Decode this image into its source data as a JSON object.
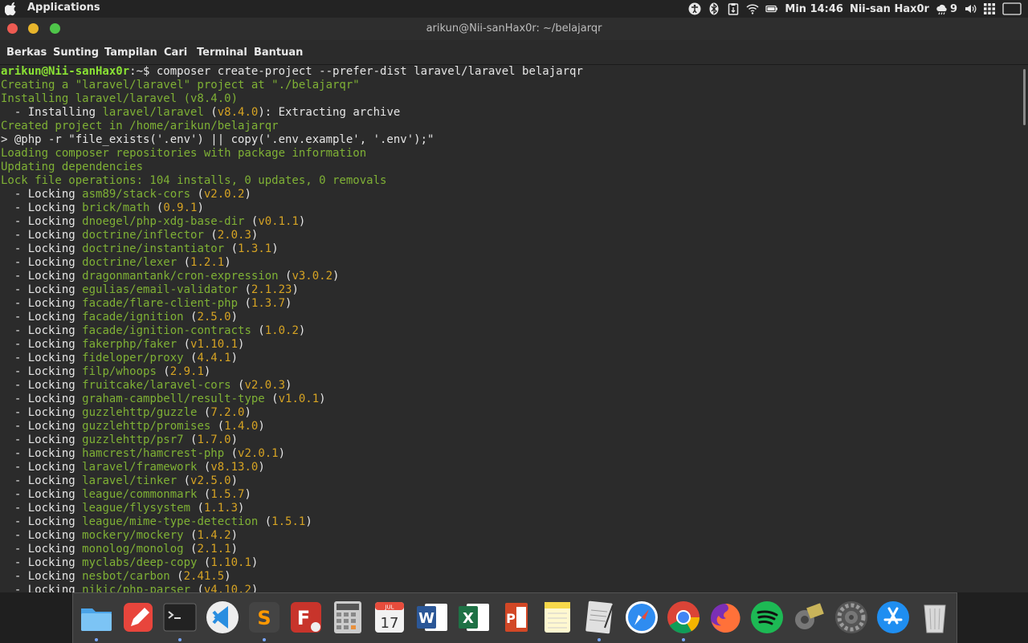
{
  "topbar": {
    "apps_label": "Applications",
    "clock": "Min 14:46",
    "user": "Nii-san Hax0r",
    "notif_count": "9",
    "icons": [
      "apple-icon",
      "accessibility-icon",
      "bluetooth-icon",
      "clipboard-icon",
      "wifi-icon",
      "battery-icon",
      "weather-icon",
      "volume-icon",
      "grid-icon",
      "window-icon"
    ]
  },
  "window": {
    "title": "arikun@Nii-sanHax0r: ~/belajarqr"
  },
  "menu": [
    "Berkas",
    "Sunting",
    "Tampilan",
    "Cari",
    "Terminal",
    "Bantuan"
  ],
  "terminal": {
    "prompt_user": "arikun@Nii-sanHax0r",
    "prompt_path": ":~$ ",
    "command": "composer create-project --prefer-dist laravel/laravel belajarqr",
    "lines": [
      {
        "t": "Creating a \"laravel/laravel\" project at \"./belajarqr\"",
        "c": "green"
      },
      {
        "t": "Installing laravel/laravel (v8.4.0)",
        "c": "green"
      },
      {
        "t": "  - Installing ",
        "c": "white",
        "pkg": "laravel/laravel",
        "ver": "v8.4.0",
        "tail": ": Extracting archive"
      },
      {
        "t": "Created project in /home/arikun/belajarqr",
        "c": "green"
      },
      {
        "t": "> @php -r \"file_exists('.env') || copy('.env.example', '.env');\"",
        "c": "white"
      },
      {
        "t": "Loading composer repositories with package information",
        "c": "green"
      },
      {
        "t": "Updating dependencies",
        "c": "green"
      },
      {
        "t": "Lock file operations: 104 installs, 0 updates, 0 removals",
        "c": "green"
      }
    ],
    "locks": [
      [
        "asm89/stack-cors",
        "v2.0.2"
      ],
      [
        "brick/math",
        "0.9.1"
      ],
      [
        "dnoegel/php-xdg-base-dir",
        "v0.1.1"
      ],
      [
        "doctrine/inflector",
        "2.0.3"
      ],
      [
        "doctrine/instantiator",
        "1.3.1"
      ],
      [
        "doctrine/lexer",
        "1.2.1"
      ],
      [
        "dragonmantank/cron-expression",
        "v3.0.2"
      ],
      [
        "egulias/email-validator",
        "2.1.23"
      ],
      [
        "facade/flare-client-php",
        "1.3.7"
      ],
      [
        "facade/ignition",
        "2.5.0"
      ],
      [
        "facade/ignition-contracts",
        "1.0.2"
      ],
      [
        "fakerphp/faker",
        "v1.10.1"
      ],
      [
        "fideloper/proxy",
        "4.4.1"
      ],
      [
        "filp/whoops",
        "2.9.1"
      ],
      [
        "fruitcake/laravel-cors",
        "v2.0.3"
      ],
      [
        "graham-campbell/result-type",
        "v1.0.1"
      ],
      [
        "guzzlehttp/guzzle",
        "7.2.0"
      ],
      [
        "guzzlehttp/promises",
        "1.4.0"
      ],
      [
        "guzzlehttp/psr7",
        "1.7.0"
      ],
      [
        "hamcrest/hamcrest-php",
        "v2.0.1"
      ],
      [
        "laravel/framework",
        "v8.13.0"
      ],
      [
        "laravel/tinker",
        "v2.5.0"
      ],
      [
        "league/commonmark",
        "1.5.7"
      ],
      [
        "league/flysystem",
        "1.1.3"
      ],
      [
        "league/mime-type-detection",
        "1.5.1"
      ],
      [
        "mockery/mockery",
        "1.4.2"
      ],
      [
        "monolog/monolog",
        "2.1.1"
      ],
      [
        "myclabs/deep-copy",
        "1.10.1"
      ],
      [
        "nesbot/carbon",
        "2.41.5"
      ],
      [
        "nikic/php-parser",
        "v4.10.2"
      ]
    ],
    "lock_prefix": "  - Locking "
  },
  "dock": {
    "items": [
      {
        "name": "files-icon",
        "color": "#4aa3e8",
        "running": true
      },
      {
        "name": "pencil-app-icon",
        "color": "#e8453c",
        "running": false
      },
      {
        "name": "terminal-icon",
        "color": "#222222",
        "running": true
      },
      {
        "name": "vscode-icon",
        "color": "#2a8ee0",
        "running": false
      },
      {
        "name": "sublime-text-icon",
        "color": "#444444",
        "running": true
      },
      {
        "name": "filezilla-icon",
        "color": "#c8342b",
        "running": false
      },
      {
        "name": "calculator-icon",
        "color": "#b0b0b0",
        "running": false
      },
      {
        "name": "calendar-icon",
        "color": "#f2f2f2",
        "running": false
      },
      {
        "name": "word-icon",
        "color": "#2b5797",
        "running": false
      },
      {
        "name": "excel-icon",
        "color": "#1e7145",
        "running": false
      },
      {
        "name": "powerpoint-icon",
        "color": "#d24726",
        "running": false
      },
      {
        "name": "notes-icon",
        "color": "#f7d84a",
        "running": false
      },
      {
        "name": "text-editor-icon",
        "color": "#e0e0e0",
        "running": true
      },
      {
        "name": "safari-icon",
        "color": "#2f8cf0",
        "running": false
      },
      {
        "name": "chrome-icon",
        "color": "#4285f4",
        "running": true
      },
      {
        "name": "firefox-icon",
        "color": "#ff7139",
        "running": false
      },
      {
        "name": "spotify-icon",
        "color": "#1db954",
        "running": false
      },
      {
        "name": "network-manager-icon",
        "color": "#8a8a5a",
        "running": false
      },
      {
        "name": "system-settings-icon",
        "color": "#9a9a9a",
        "running": false
      },
      {
        "name": "app-store-icon",
        "color": "#1f8ef1",
        "running": false
      },
      {
        "name": "trash-icon",
        "color": "#d8d8d8",
        "running": false
      }
    ],
    "calendar_month": "JUL",
    "calendar_day": "17"
  }
}
